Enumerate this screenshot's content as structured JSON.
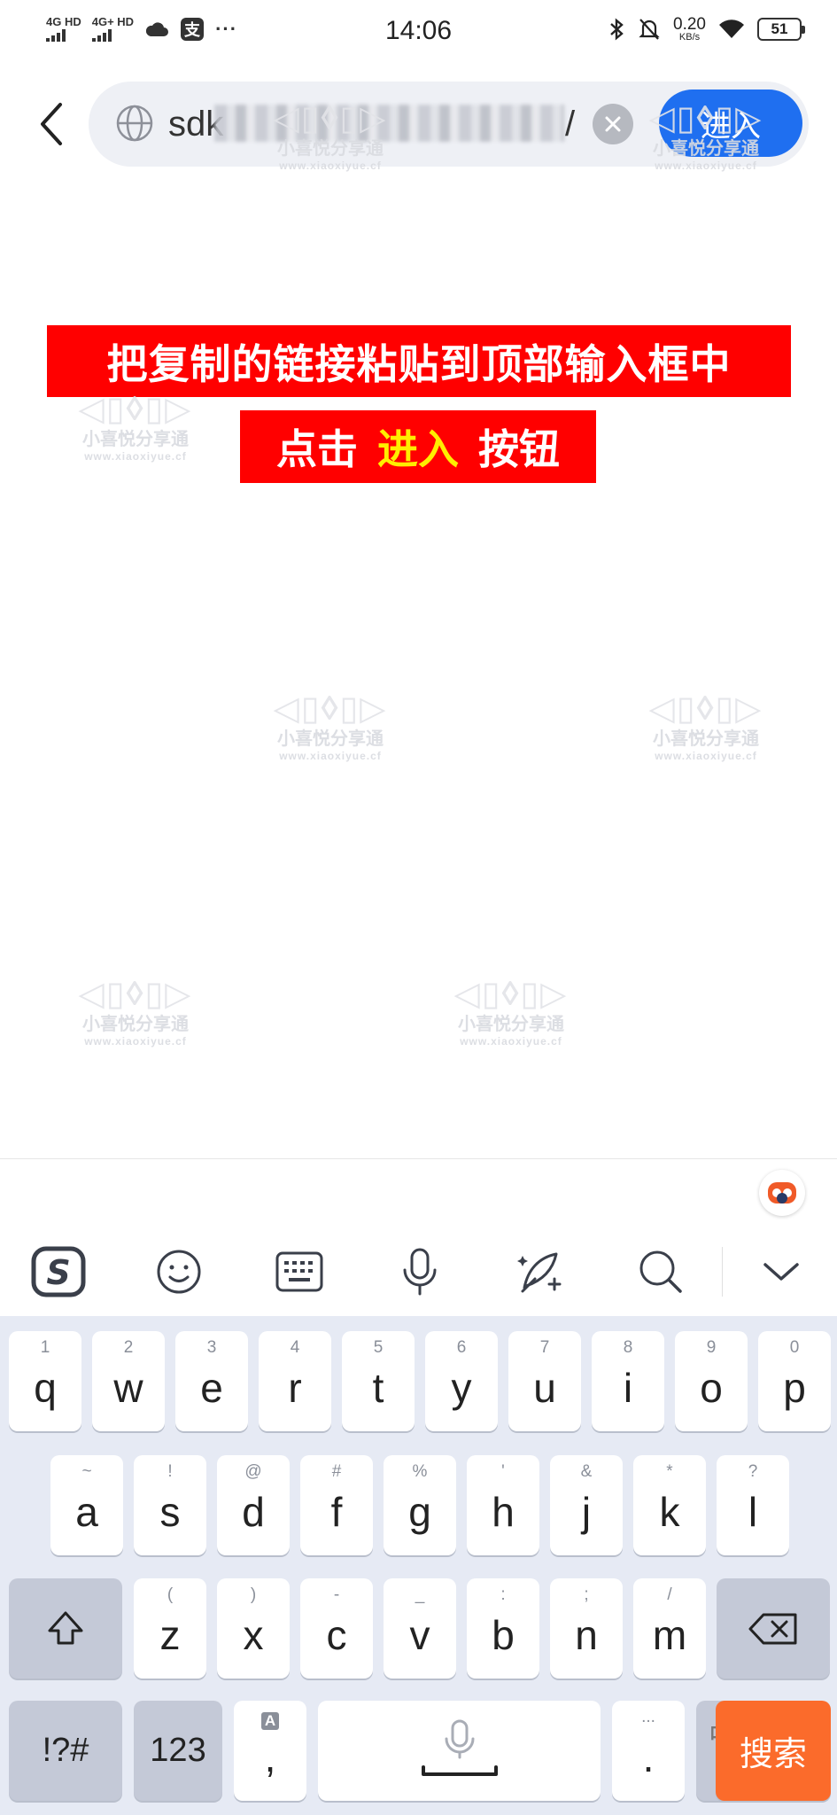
{
  "status_bar": {
    "sim1": "4G HD",
    "sim2": "4G+ HD",
    "time": "14:06",
    "net_speed_value": "0.20",
    "net_speed_unit": "KB/s",
    "battery": "51"
  },
  "address_bar": {
    "url_start": "sdk",
    "url_end": "/",
    "enter_label": "进入"
  },
  "instructions": {
    "line1": "把复制的链接粘贴到顶部输入框中",
    "line2_prefix": "点击",
    "line2_highlight": "进入",
    "line2_suffix": "按钮"
  },
  "watermark": {
    "name": "小喜悦分享通",
    "url": "www.xiaoxiyue.cf"
  },
  "keyboard": {
    "row1": [
      {
        "hint": "1",
        "key": "q"
      },
      {
        "hint": "2",
        "key": "w"
      },
      {
        "hint": "3",
        "key": "e"
      },
      {
        "hint": "4",
        "key": "r"
      },
      {
        "hint": "5",
        "key": "t"
      },
      {
        "hint": "6",
        "key": "y"
      },
      {
        "hint": "7",
        "key": "u"
      },
      {
        "hint": "8",
        "key": "i"
      },
      {
        "hint": "9",
        "key": "o"
      },
      {
        "hint": "0",
        "key": "p"
      }
    ],
    "row2": [
      {
        "hint": "~",
        "key": "a"
      },
      {
        "hint": "!",
        "key": "s"
      },
      {
        "hint": "@",
        "key": "d"
      },
      {
        "hint": "#",
        "key": "f"
      },
      {
        "hint": "%",
        "key": "g"
      },
      {
        "hint": "'",
        "key": "h"
      },
      {
        "hint": "&",
        "key": "j"
      },
      {
        "hint": "*",
        "key": "k"
      },
      {
        "hint": "?",
        "key": "l"
      }
    ],
    "row3": [
      {
        "hint": "(",
        "key": "z"
      },
      {
        "hint": ")",
        "key": "x"
      },
      {
        "hint": "-",
        "key": "c"
      },
      {
        "hint": "_",
        "key": "v"
      },
      {
        "hint": ":",
        "key": "b"
      },
      {
        "hint": ";",
        "key": "n"
      },
      {
        "hint": "/",
        "key": "m"
      }
    ],
    "symbols_label": "!?#",
    "numbers_label": "123",
    "comma_label": ",",
    "comma_hint": "A",
    "period_label": ".",
    "period_hint": "...",
    "lang_top": "中",
    "lang_bottom": "英",
    "search_label": "搜索"
  }
}
